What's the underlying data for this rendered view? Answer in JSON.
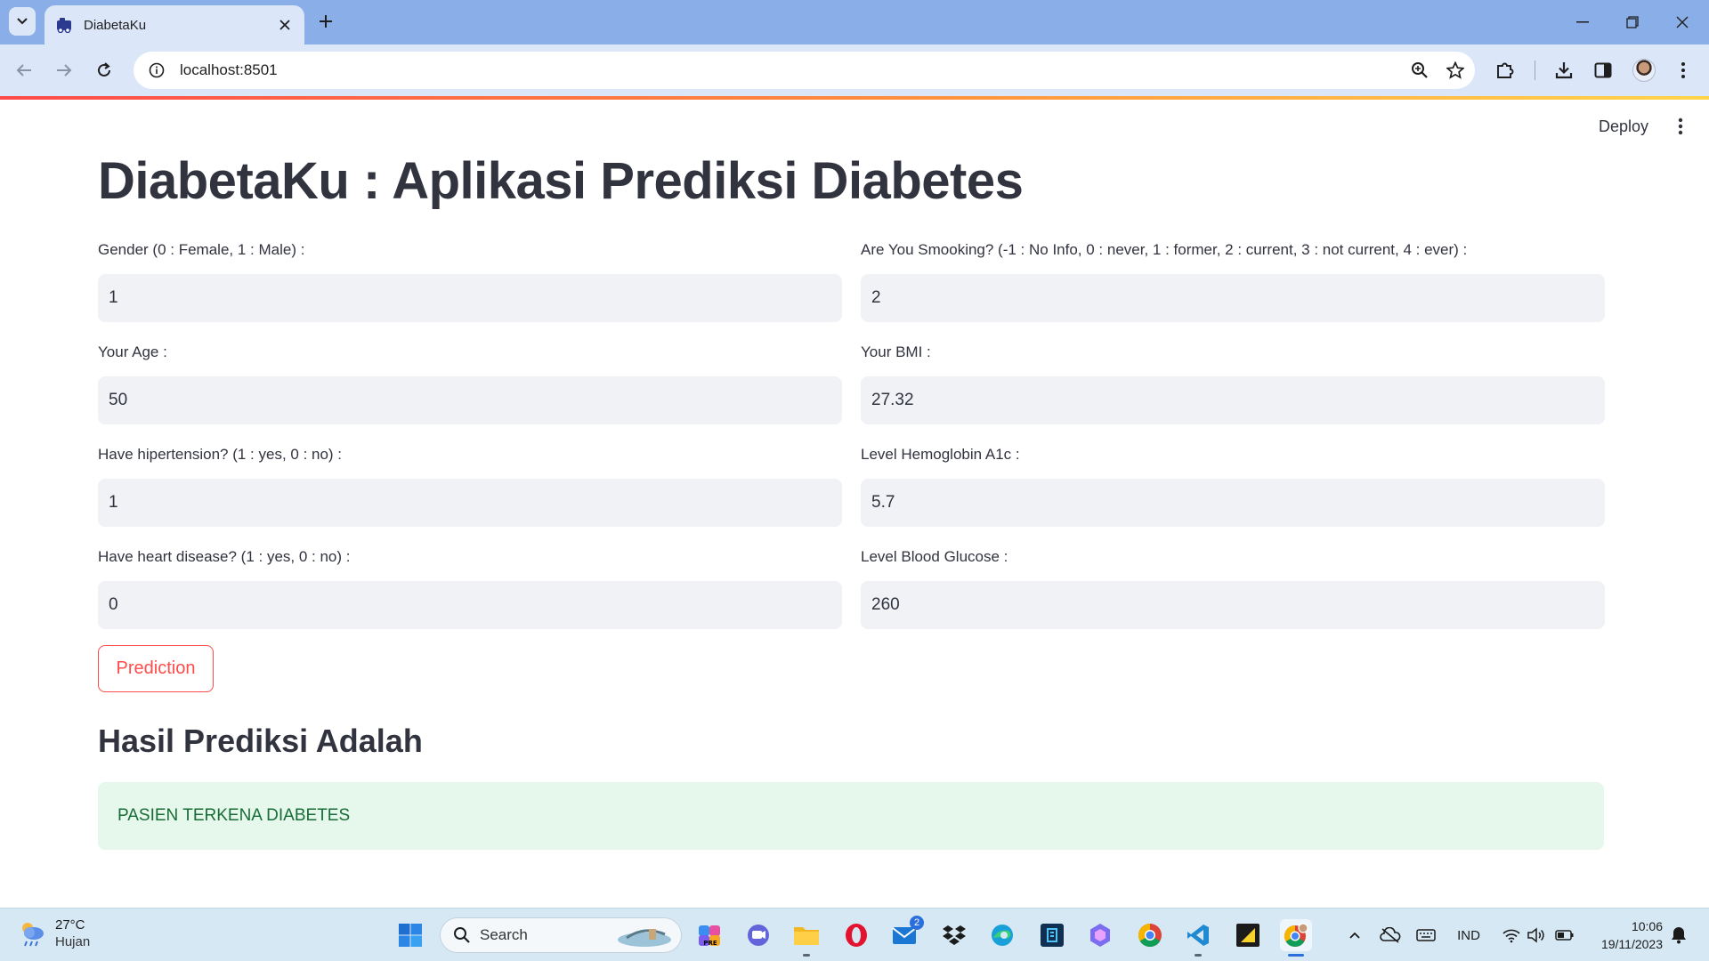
{
  "browser": {
    "tab_title": "DiabetaKu",
    "url": "localhost:8501"
  },
  "app": {
    "deploy_label": "Deploy",
    "title": "DiabetaKu : Aplikasi Prediksi Diabetes",
    "fields": {
      "gender": {
        "label": "Gender (0 : Female, 1 : Male) :",
        "value": "1"
      },
      "smoking": {
        "label": "Are You Smooking? (-1 : No Info, 0 : never, 1 : former, 2 : current, 3 : not current, 4 : ever) :",
        "value": "2"
      },
      "age": {
        "label": "Your Age :",
        "value": "50"
      },
      "bmi": {
        "label": "Your BMI :",
        "value": "27.32"
      },
      "hypertension": {
        "label": "Have hipertension? (1 : yes, 0 : no) :",
        "value": "1"
      },
      "hba1c": {
        "label": "Level Hemoglobin A1c :",
        "value": "5.7"
      },
      "heart_disease": {
        "label": "Have heart disease? (1 : yes, 0 : no) :",
        "value": "0"
      },
      "glucose": {
        "label": "Level Blood Glucose :",
        "value": "260"
      }
    },
    "predict_button": "Prediction",
    "result_heading": "Hasil Prediksi Adalah",
    "result_text": "PASIEN TERKENA DIABETES",
    "colors": {
      "accent": "#ff4b4b",
      "success_bg": "#e6f8ec",
      "success_text": "#176c36",
      "input_bg": "#f0f2f6"
    }
  },
  "taskbar": {
    "weather_temp": "27°C",
    "weather_desc": "Hujan",
    "search_label": "Search",
    "mail_badge": "2",
    "language": "IND",
    "time": "10:06",
    "date": "19/11/2023"
  }
}
